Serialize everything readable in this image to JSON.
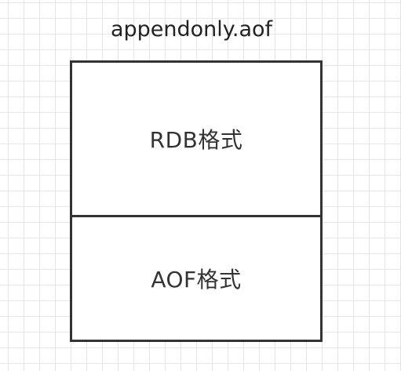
{
  "diagram": {
    "file_name": "appendonly.aof",
    "sections": [
      {
        "label": "RDB格式"
      },
      {
        "label": "AOF格式"
      }
    ]
  }
}
